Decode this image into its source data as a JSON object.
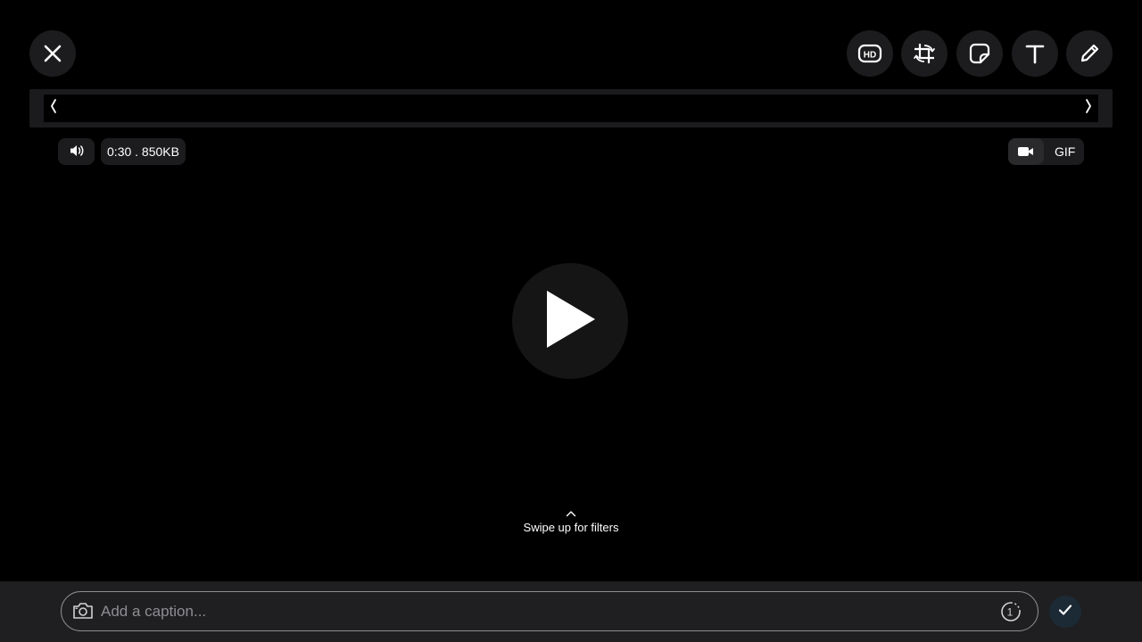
{
  "toolbar": {
    "close_icon": "close-icon",
    "hd_icon": "hd-quality-icon",
    "hd_label": "HD",
    "crop_icon": "crop-rotate-icon",
    "sticker_icon": "sticker-icon",
    "text_icon": "text-icon",
    "draw_icon": "pencil-icon"
  },
  "video_info": {
    "mute_icon": "speaker-icon",
    "duration_size": "0:30 . 850KB",
    "gif_toggle_icon": "video-camera-icon",
    "gif_label": "GIF"
  },
  "trimmer": {
    "left_handle_icon": "chevron-left-icon",
    "right_handle_icon": "chevron-right-icon"
  },
  "player": {
    "play_icon": "play-icon"
  },
  "filters_hint": {
    "text": "Swipe up for filters",
    "icon": "chevron-up-icon"
  },
  "caption": {
    "camera_icon": "camera-icon",
    "placeholder": "Add a caption...",
    "value": "",
    "view_once_icon": "view-once-icon",
    "view_once_label": "1"
  },
  "send": {
    "icon": "checkmark-icon"
  },
  "colors": {
    "background": "#000000",
    "button_bg": "#1c1c1e",
    "bottom_bar": "#1f1f21",
    "placeholder": "#8e8e93",
    "send_bg": "#1c2a36"
  }
}
